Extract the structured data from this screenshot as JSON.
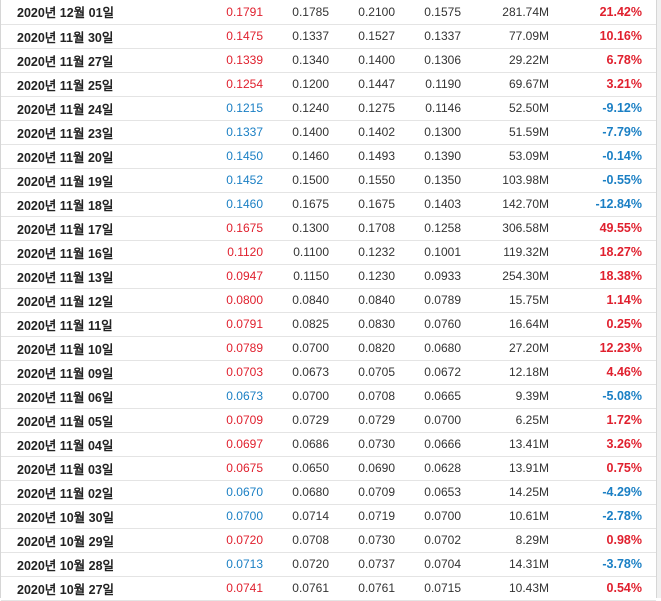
{
  "colors": {
    "up": "#e0202e",
    "down": "#1a7fc4",
    "text": "#333333"
  },
  "rows": [
    {
      "date": "2020년 12월 01일",
      "close": "0.1791",
      "open": "0.1785",
      "high": "0.2100",
      "low": "0.1575",
      "volume": "281.74M",
      "change": "21.42%",
      "dir": "up"
    },
    {
      "date": "2020년 11월 30일",
      "close": "0.1475",
      "open": "0.1337",
      "high": "0.1527",
      "low": "0.1337",
      "volume": "77.09M",
      "change": "10.16%",
      "dir": "up"
    },
    {
      "date": "2020년 11월 27일",
      "close": "0.1339",
      "open": "0.1340",
      "high": "0.1400",
      "low": "0.1306",
      "volume": "29.22M",
      "change": "6.78%",
      "dir": "up"
    },
    {
      "date": "2020년 11월 25일",
      "close": "0.1254",
      "open": "0.1200",
      "high": "0.1447",
      "low": "0.1190",
      "volume": "69.67M",
      "change": "3.21%",
      "dir": "up"
    },
    {
      "date": "2020년 11월 24일",
      "close": "0.1215",
      "open": "0.1240",
      "high": "0.1275",
      "low": "0.1146",
      "volume": "52.50M",
      "change": "-9.12%",
      "dir": "down"
    },
    {
      "date": "2020년 11월 23일",
      "close": "0.1337",
      "open": "0.1400",
      "high": "0.1402",
      "low": "0.1300",
      "volume": "51.59M",
      "change": "-7.79%",
      "dir": "down"
    },
    {
      "date": "2020년 11월 20일",
      "close": "0.1450",
      "open": "0.1460",
      "high": "0.1493",
      "low": "0.1390",
      "volume": "53.09M",
      "change": "-0.14%",
      "dir": "down"
    },
    {
      "date": "2020년 11월 19일",
      "close": "0.1452",
      "open": "0.1500",
      "high": "0.1550",
      "low": "0.1350",
      "volume": "103.98M",
      "change": "-0.55%",
      "dir": "down"
    },
    {
      "date": "2020년 11월 18일",
      "close": "0.1460",
      "open": "0.1675",
      "high": "0.1675",
      "low": "0.1403",
      "volume": "142.70M",
      "change": "-12.84%",
      "dir": "down"
    },
    {
      "date": "2020년 11월 17일",
      "close": "0.1675",
      "open": "0.1300",
      "high": "0.1708",
      "low": "0.1258",
      "volume": "306.58M",
      "change": "49.55%",
      "dir": "up"
    },
    {
      "date": "2020년 11월 16일",
      "close": "0.1120",
      "open": "0.1100",
      "high": "0.1232",
      "low": "0.1001",
      "volume": "119.32M",
      "change": "18.27%",
      "dir": "up"
    },
    {
      "date": "2020년 11월 13일",
      "close": "0.0947",
      "open": "0.1150",
      "high": "0.1230",
      "low": "0.0933",
      "volume": "254.30M",
      "change": "18.38%",
      "dir": "up"
    },
    {
      "date": "2020년 11월 12일",
      "close": "0.0800",
      "open": "0.0840",
      "high": "0.0840",
      "low": "0.0789",
      "volume": "15.75M",
      "change": "1.14%",
      "dir": "up"
    },
    {
      "date": "2020년 11월 11일",
      "close": "0.0791",
      "open": "0.0825",
      "high": "0.0830",
      "low": "0.0760",
      "volume": "16.64M",
      "change": "0.25%",
      "dir": "up"
    },
    {
      "date": "2020년 11월 10일",
      "close": "0.0789",
      "open": "0.0700",
      "high": "0.0820",
      "low": "0.0680",
      "volume": "27.20M",
      "change": "12.23%",
      "dir": "up"
    },
    {
      "date": "2020년 11월 09일",
      "close": "0.0703",
      "open": "0.0673",
      "high": "0.0705",
      "low": "0.0672",
      "volume": "12.18M",
      "change": "4.46%",
      "dir": "up"
    },
    {
      "date": "2020년 11월 06일",
      "close": "0.0673",
      "open": "0.0700",
      "high": "0.0708",
      "low": "0.0665",
      "volume": "9.39M",
      "change": "-5.08%",
      "dir": "down"
    },
    {
      "date": "2020년 11월 05일",
      "close": "0.0709",
      "open": "0.0729",
      "high": "0.0729",
      "low": "0.0700",
      "volume": "6.25M",
      "change": "1.72%",
      "dir": "up"
    },
    {
      "date": "2020년 11월 04일",
      "close": "0.0697",
      "open": "0.0686",
      "high": "0.0730",
      "low": "0.0666",
      "volume": "13.41M",
      "change": "3.26%",
      "dir": "up"
    },
    {
      "date": "2020년 11월 03일",
      "close": "0.0675",
      "open": "0.0650",
      "high": "0.0690",
      "low": "0.0628",
      "volume": "13.91M",
      "change": "0.75%",
      "dir": "up"
    },
    {
      "date": "2020년 11월 02일",
      "close": "0.0670",
      "open": "0.0680",
      "high": "0.0709",
      "low": "0.0653",
      "volume": "14.25M",
      "change": "-4.29%",
      "dir": "down"
    },
    {
      "date": "2020년 10월 30일",
      "close": "0.0700",
      "open": "0.0714",
      "high": "0.0719",
      "low": "0.0700",
      "volume": "10.61M",
      "change": "-2.78%",
      "dir": "down"
    },
    {
      "date": "2020년 10월 29일",
      "close": "0.0720",
      "open": "0.0708",
      "high": "0.0730",
      "low": "0.0702",
      "volume": "8.29M",
      "change": "0.98%",
      "dir": "up"
    },
    {
      "date": "2020년 10월 28일",
      "close": "0.0713",
      "open": "0.0720",
      "high": "0.0737",
      "low": "0.0704",
      "volume": "14.31M",
      "change": "-3.78%",
      "dir": "down"
    },
    {
      "date": "2020년 10월 27일",
      "close": "0.0741",
      "open": "0.0761",
      "high": "0.0761",
      "low": "0.0715",
      "volume": "10.43M",
      "change": "0.54%",
      "dir": "up"
    }
  ]
}
